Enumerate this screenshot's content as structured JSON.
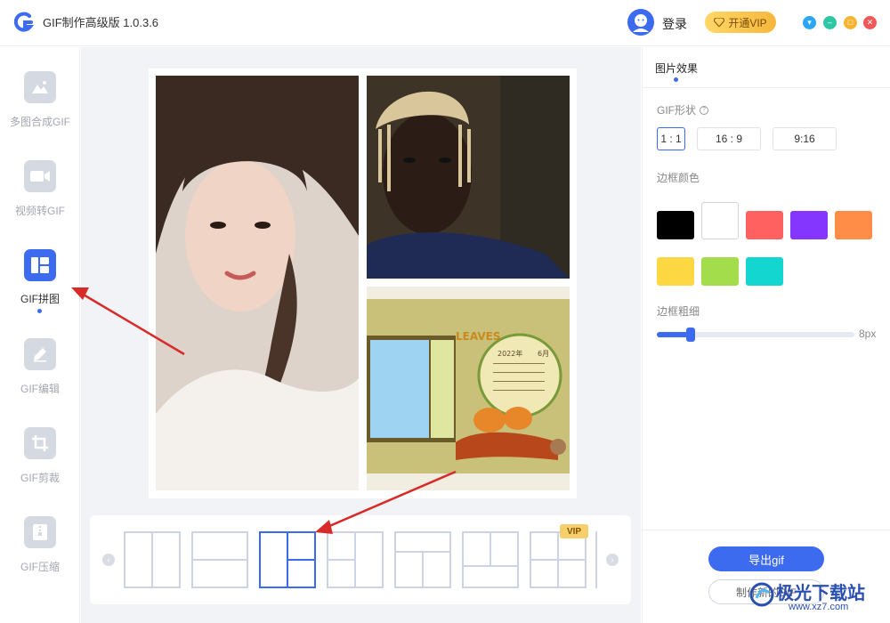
{
  "app": {
    "title": "GIF制作高级版 1.0.3.6",
    "login_label": "登录",
    "vip_label": "开通VIP"
  },
  "window_controls": [
    {
      "name": "menu",
      "color": "#2aa6f5"
    },
    {
      "name": "minimize",
      "color": "#2ec7a5"
    },
    {
      "name": "maximize",
      "color": "#f5b531"
    },
    {
      "name": "close",
      "color": "#f25757"
    }
  ],
  "sidebar": {
    "items": [
      {
        "label": "多图合成GIF",
        "icon": "mountain-image-icon",
        "active": false
      },
      {
        "label": "视频转GIF",
        "icon": "video-camera-icon",
        "active": false
      },
      {
        "label": "GIF拼图",
        "icon": "collage-icon",
        "active": true
      },
      {
        "label": "GIF编辑",
        "icon": "pencil-edit-icon",
        "active": false
      },
      {
        "label": "GIF剪裁",
        "icon": "crop-icon",
        "active": false
      },
      {
        "label": "GIF压缩",
        "icon": "zip-file-icon",
        "active": false
      }
    ]
  },
  "collage": {
    "photos": [
      "portrait-woman",
      "portrait-man",
      "calendar-scrapbook"
    ],
    "calendar_year": "2022年",
    "calendar_month": "6月",
    "calendar_word": "LEAVES"
  },
  "layouts": {
    "selected_index": 2,
    "vip_badge": "VIP"
  },
  "panel": {
    "tab_label": "图片效果",
    "shape_label": "GIF形状",
    "shapes": [
      "1 : 1",
      "16 : 9",
      "9:16"
    ],
    "selected_shape": 0,
    "border_color_label": "边框颜色",
    "colors": [
      "#000000",
      "#ffffff",
      "#ff6161",
      "#8436ff",
      "#ff8c47",
      "#fdd843",
      "#a4dd4c",
      "#12d6cf"
    ],
    "selected_color": 1,
    "border_width_label": "边框粗细",
    "border_width_value": "8px",
    "border_width_fraction": 0.17,
    "export_label": "导出gif",
    "new_label": "制作新的GIF"
  },
  "watermark": {
    "text": "极光下载站",
    "url": "www.xz7.com"
  }
}
